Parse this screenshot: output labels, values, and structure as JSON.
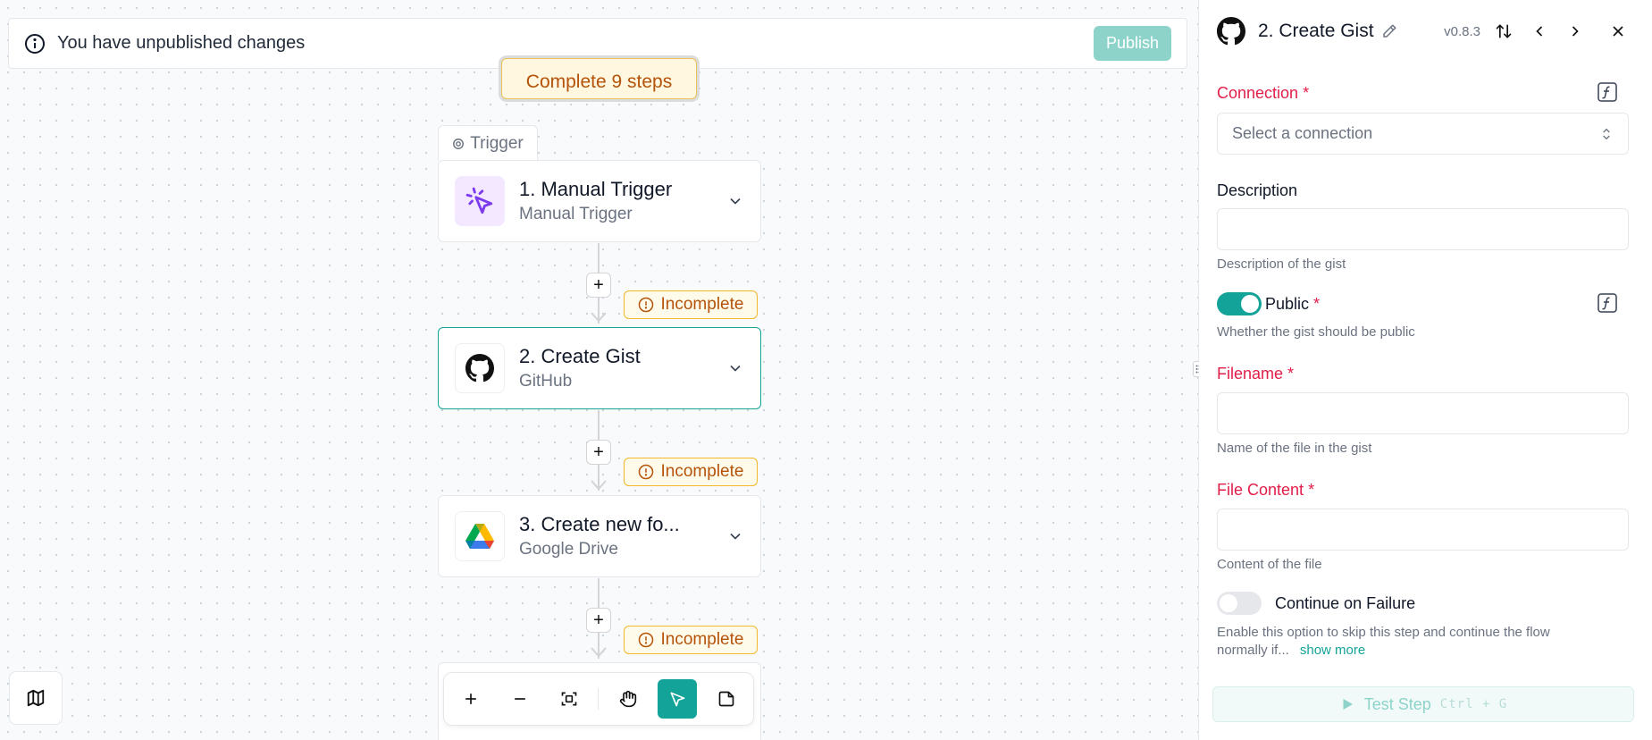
{
  "banner": {
    "message": "You have unpublished changes",
    "publish_label": "Publish"
  },
  "canvas": {
    "complete_label": "Complete 9 steps",
    "trigger_tab_label": "Trigger",
    "incomplete_label": "Incomplete",
    "steps": [
      {
        "title": "1. Manual Trigger",
        "subtitle": "Manual Trigger",
        "icon": "cursor-click-icon"
      },
      {
        "title": "2. Create Gist",
        "subtitle": "GitHub",
        "icon": "github-icon"
      },
      {
        "title": "3. Create new fo...",
        "subtitle": "Google Drive",
        "icon": "google-drive-icon"
      }
    ],
    "toolbar": [
      "zoom-in-icon",
      "zoom-out-icon",
      "fit-view-icon",
      "hand-icon",
      "pointer-icon",
      "note-icon"
    ]
  },
  "panel": {
    "title": "2. Create Gist",
    "version": "v0.8.3",
    "connection": {
      "label": "Connection",
      "required": "*",
      "placeholder": "Select a connection"
    },
    "description": {
      "label": "Description",
      "value": "",
      "help": "Description of the gist"
    },
    "public": {
      "label": "Public",
      "required": "*",
      "help": "Whether the gist should be public",
      "enabled": true
    },
    "filename": {
      "label": "Filename",
      "required": "*",
      "value": "",
      "help": "Name of the file in the gist"
    },
    "file_content": {
      "label": "File Content",
      "required": "*",
      "value": "",
      "help": "Content of the file"
    },
    "continue_on_failure": {
      "label": "Continue on Failure",
      "enabled": false,
      "help_line1": "Enable this option to skip this step and continue the flow",
      "help_line2": "normally if...",
      "show_more": "show more"
    },
    "test_step": {
      "label": "Test Step",
      "shortcut": "Ctrl + G"
    }
  },
  "colors": {
    "accent": "#14a398",
    "required": "#e11d48",
    "warning": "#f1b62a",
    "warning_text": "#b45309"
  }
}
